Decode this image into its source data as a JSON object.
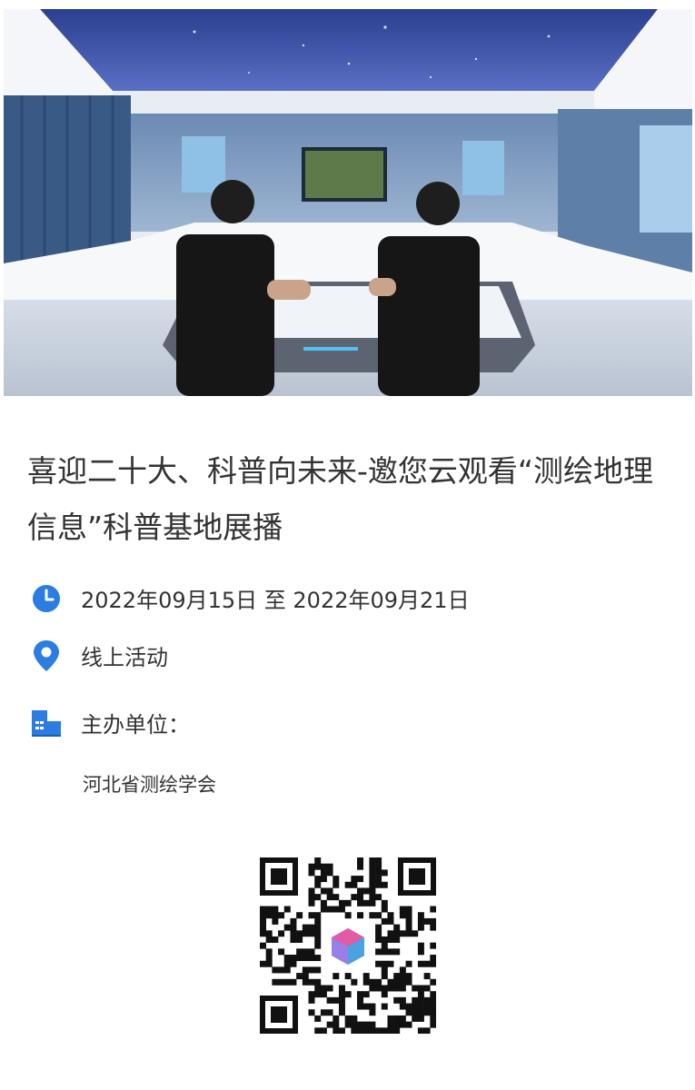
{
  "event": {
    "title": "喜迎二十大、科普向未来-邀您云观看“测绘地理信息”科普基地展播",
    "date": "2022年09月15日 至 2022年09月21日",
    "location": "线上活动",
    "organizer_label": "主办单位：",
    "organizer_name": "河北省测绘学会"
  },
  "icons": {
    "date": "clock-icon",
    "location": "location-pin-icon",
    "organizer": "building-icon"
  },
  "colors": {
    "accent": "#2b7de1",
    "text": "#333333"
  }
}
